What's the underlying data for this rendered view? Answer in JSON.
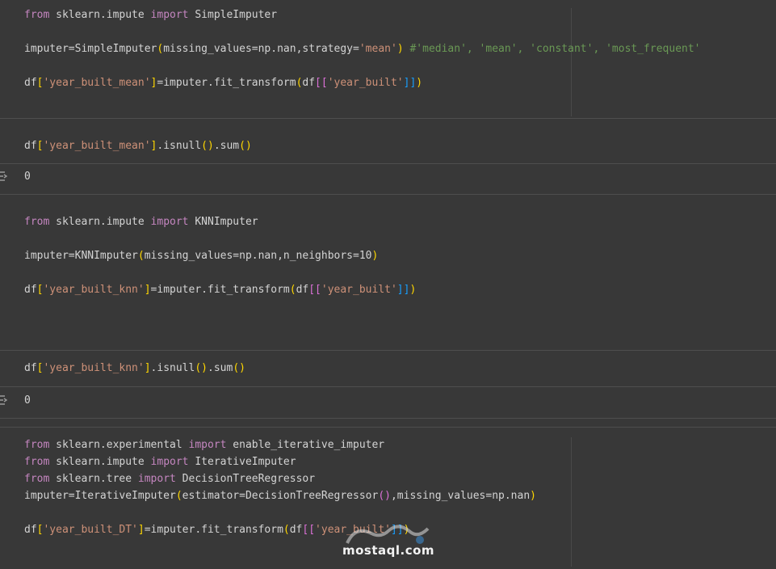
{
  "cells": [
    {
      "lines": [
        [
          [
            "kw",
            "from"
          ],
          [
            "mod",
            " sklearn.impute "
          ],
          [
            "kw",
            "import"
          ],
          [
            "mod",
            " SimpleImputer"
          ]
        ],
        [],
        [
          [
            "mod",
            "imputer=SimpleImputer"
          ],
          [
            "p1",
            "("
          ],
          [
            "mod",
            "missing_values=np.nan,strategy="
          ],
          [
            "str",
            "'mean'"
          ],
          [
            "p1",
            ")"
          ],
          [
            "mod",
            " "
          ],
          [
            "cm",
            "#'median', 'mean', 'constant', 'most_frequent'"
          ]
        ],
        [],
        [
          [
            "mod",
            "df"
          ],
          [
            "p1",
            "["
          ],
          [
            "str",
            "'year_built_mean'"
          ],
          [
            "p1",
            "]"
          ],
          [
            "mod",
            "=imputer.fit_transform"
          ],
          [
            "p1",
            "("
          ],
          [
            "mod",
            "df"
          ],
          [
            "p2",
            "[["
          ],
          [
            "str",
            "'year_built'"
          ],
          [
            "p3",
            "]]"
          ],
          [
            "p1",
            ")"
          ]
        ]
      ]
    },
    {
      "lines": [
        [
          [
            "mod",
            "df"
          ],
          [
            "p1",
            "["
          ],
          [
            "str",
            "'year_built_mean'"
          ],
          [
            "p1",
            "]"
          ],
          [
            "mod",
            ".isnull"
          ],
          [
            "p1",
            "()"
          ],
          [
            "mod",
            ".sum"
          ],
          [
            "p1",
            "()"
          ]
        ]
      ],
      "output": "0"
    },
    {
      "lines": [
        [
          [
            "kw",
            "from"
          ],
          [
            "mod",
            " sklearn.impute "
          ],
          [
            "kw",
            "import"
          ],
          [
            "mod",
            " KNNImputer"
          ]
        ],
        [],
        [
          [
            "mod",
            "imputer=KNNImputer"
          ],
          [
            "p1",
            "("
          ],
          [
            "mod",
            "missing_values=np.nan,n_neighbors=10"
          ],
          [
            "p1",
            ")"
          ]
        ],
        [],
        [
          [
            "mod",
            "df"
          ],
          [
            "p1",
            "["
          ],
          [
            "str",
            "'year_built_knn'"
          ],
          [
            "p1",
            "]"
          ],
          [
            "mod",
            "=imputer.fit_transform"
          ],
          [
            "p1",
            "("
          ],
          [
            "mod",
            "df"
          ],
          [
            "p2",
            "[["
          ],
          [
            "str",
            "'year_built'"
          ],
          [
            "p3",
            "]]"
          ],
          [
            "p1",
            ")"
          ]
        ]
      ]
    },
    {
      "lines": [
        [
          [
            "mod",
            "df"
          ],
          [
            "p1",
            "["
          ],
          [
            "str",
            "'year_built_knn'"
          ],
          [
            "p1",
            "]"
          ],
          [
            "mod",
            ".isnull"
          ],
          [
            "p1",
            "()"
          ],
          [
            "mod",
            ".sum"
          ],
          [
            "p1",
            "()"
          ]
        ]
      ],
      "output": "0"
    },
    {
      "lines": [
        [
          [
            "kw",
            "from"
          ],
          [
            "mod",
            " sklearn.experimental "
          ],
          [
            "kw",
            "import"
          ],
          [
            "mod",
            " enable_iterative_imputer"
          ]
        ],
        [
          [
            "kw",
            "from"
          ],
          [
            "mod",
            " sklearn.impute "
          ],
          [
            "kw",
            "import"
          ],
          [
            "mod",
            " IterativeImputer"
          ]
        ],
        [
          [
            "kw",
            "from"
          ],
          [
            "mod",
            " sklearn.tree "
          ],
          [
            "kw",
            "import"
          ],
          [
            "mod",
            " DecisionTreeRegressor"
          ]
        ],
        [
          [
            "mod",
            "imputer=IterativeImputer"
          ],
          [
            "p1",
            "("
          ],
          [
            "mod",
            "estimator=DecisionTreeRegressor"
          ],
          [
            "p2",
            "()"
          ],
          [
            "mod",
            ",missing_values=np.nan"
          ],
          [
            "p1",
            ")"
          ]
        ],
        [],
        [
          [
            "mod",
            "df"
          ],
          [
            "p1",
            "["
          ],
          [
            "str",
            "'year_built_DT'"
          ],
          [
            "p1",
            "]"
          ],
          [
            "mod",
            "=imputer.fit_transform"
          ],
          [
            "p1",
            "("
          ],
          [
            "mod",
            "df"
          ],
          [
            "p2",
            "[["
          ],
          [
            "str",
            "'year_built'"
          ],
          [
            "p3",
            "]]"
          ],
          [
            "p1",
            ")"
          ]
        ]
      ]
    }
  ],
  "watermark": "mostaql.com",
  "colors": {
    "background": "#383838",
    "keyword": "#c586c0",
    "string": "#ce9178",
    "comment": "#6a9955",
    "bracket1": "#ffd700",
    "bracket2": "#da70d6",
    "bracket3": "#179fff"
  }
}
